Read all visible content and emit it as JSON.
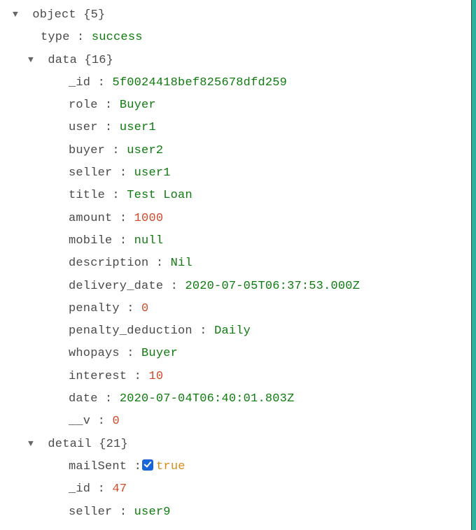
{
  "root": {
    "label": "object",
    "count": "{5}"
  },
  "type": {
    "key": "type",
    "value": "success"
  },
  "data": {
    "key": "data",
    "count": "{16}",
    "fields": {
      "_id": {
        "key": "_id",
        "value": "5f0024418bef825678dfd259",
        "kind": "str"
      },
      "role": {
        "key": "role",
        "value": "Buyer",
        "kind": "str"
      },
      "user": {
        "key": "user",
        "value": "user1",
        "kind": "str"
      },
      "buyer": {
        "key": "buyer",
        "value": "user2",
        "kind": "str"
      },
      "seller": {
        "key": "seller",
        "value": "user1",
        "kind": "str"
      },
      "title": {
        "key": "title",
        "value": "Test Loan",
        "kind": "str"
      },
      "amount": {
        "key": "amount",
        "value": "1000",
        "kind": "num"
      },
      "mobile": {
        "key": "mobile",
        "value": "null",
        "kind": "null"
      },
      "description": {
        "key": "description",
        "value": "Nil",
        "kind": "str"
      },
      "delivery_date": {
        "key": "delivery_date",
        "value": "2020-07-05T06:37:53.000Z",
        "kind": "str"
      },
      "penalty": {
        "key": "penalty",
        "value": "0",
        "kind": "num"
      },
      "penalty_deduction": {
        "key": "penalty_deduction",
        "value": "Daily",
        "kind": "str"
      },
      "whopays": {
        "key": "whopays",
        "value": "Buyer",
        "kind": "str"
      },
      "interest": {
        "key": "interest",
        "value": "10",
        "kind": "num"
      },
      "date": {
        "key": "date",
        "value": "2020-07-04T06:40:01.803Z",
        "kind": "str"
      },
      "__v": {
        "key": "__v",
        "value": "0",
        "kind": "num"
      }
    }
  },
  "detail": {
    "key": "detail",
    "count": "{21}",
    "fields": {
      "mailSent": {
        "key": "mailSent",
        "value": "true",
        "kind": "bool"
      },
      "_id": {
        "key": "_id",
        "value": "47",
        "kind": "num"
      },
      "seller": {
        "key": "seller",
        "value": "user9",
        "kind": "str"
      }
    }
  },
  "ui": {
    "colon": " : "
  }
}
